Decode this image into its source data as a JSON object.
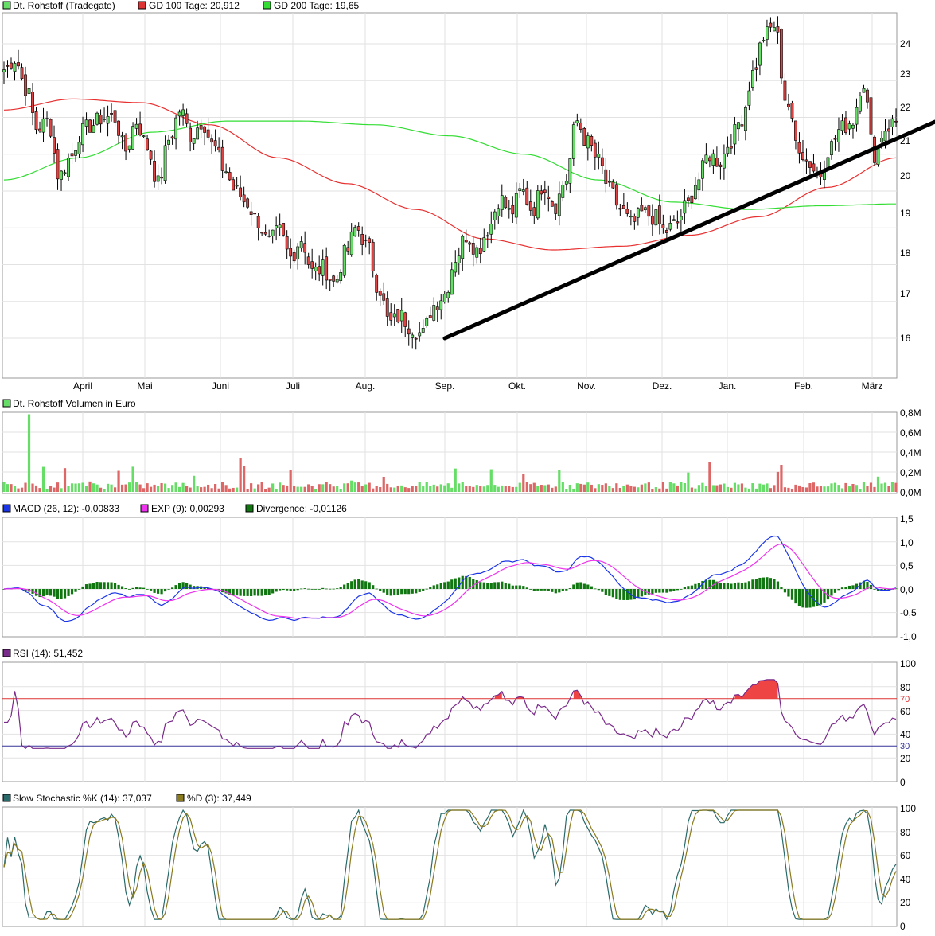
{
  "colors": {
    "up": "#66dd66",
    "down": "#dd4444",
    "gd100": "#e83030",
    "gd200": "#33dd33",
    "macd": "#1a35e8",
    "exp": "#ee33ee",
    "divergence": "#107710",
    "rsi": "#7a2a8a",
    "rsi_fill": "#ee4444",
    "stoch_k": "#2a6a6a",
    "stoch_d": "#8a7a20",
    "trendline": "#000000",
    "rsi70": "#dd3333",
    "rsi30": "#333399"
  },
  "months": [
    "April",
    "Mai",
    "Juni",
    "Juli",
    "Aug.",
    "Sep.",
    "Okt.",
    "Nov.",
    "Dez.",
    "Jan.",
    "Feb.",
    "März"
  ],
  "legends": {
    "price": [
      {
        "label": "Dt. Rohstoff (Tradegate)",
        "color": "#66dd66"
      },
      {
        "label": "GD 100 Tage: 20,912",
        "color": "#dd3333"
      },
      {
        "label": "GD 200 Tage: 19,65",
        "color": "#33dd33"
      }
    ],
    "volume": [
      {
        "label": "Dt. Rohstoff Volumen in Euro",
        "color": "#66dd66"
      }
    ],
    "macd": [
      {
        "label": "MACD (26, 12): -0,00833",
        "color": "#1a35e8"
      },
      {
        "label": "EXP (9): 0,00293",
        "color": "#ee33ee"
      },
      {
        "label": "Divergence: -0,01126",
        "color": "#107710"
      }
    ],
    "rsi": [
      {
        "label": "RSI (14): 51,452",
        "color": "#7a2a8a"
      }
    ],
    "stoch": [
      {
        "label": "Slow Stochastic %K (14): 37,037",
        "color": "#2a6a6a"
      },
      {
        "label": "%D (3): 37,449",
        "color": "#8a7a20"
      }
    ]
  },
  "chart_data": [
    {
      "type": "candlestick",
      "panel": "price",
      "title": "Dt. Rohstoff (Tradegate)",
      "y_ticks": [
        "16",
        "17",
        "18",
        "19",
        "20",
        "21",
        "22",
        "23",
        "24"
      ],
      "ylim": [
        15,
        25
      ],
      "x_labels": [
        "April",
        "Mai",
        "Juni",
        "Juli",
        "Aug.",
        "Sep.",
        "Okt.",
        "Nov.",
        "Dez.",
        "Jan.",
        "Feb.",
        "März"
      ],
      "close_anchors": [
        [
          "Mär",
          23.3
        ],
        [
          "Mär",
          23.6
        ],
        [
          "Mär",
          22.8
        ],
        [
          "Apr",
          21.7
        ],
        [
          "Apr",
          21.9
        ],
        [
          "Apr",
          20.4
        ],
        [
          "Apr",
          20.9
        ],
        [
          "Apr",
          21.6
        ],
        [
          "Apr",
          21.8
        ],
        [
          "Apr",
          22.0
        ],
        [
          "Mai",
          22.0
        ],
        [
          "Mai",
          21.1
        ],
        [
          "Mai",
          21.9
        ],
        [
          "Mai",
          21.2
        ],
        [
          "Mai",
          20.2
        ],
        [
          "Mai",
          21.4
        ],
        [
          "Mai",
          22.2
        ],
        [
          "Mai",
          21.5
        ],
        [
          "Jun",
          21.9
        ],
        [
          "Jun",
          21.2
        ],
        [
          "Jun",
          20.6
        ],
        [
          "Jun",
          20.0
        ],
        [
          "Jun",
          19.7
        ],
        [
          "Jun",
          19.2
        ],
        [
          "Jun",
          18.6
        ],
        [
          "Jul",
          18.9
        ],
        [
          "Jul",
          18.2
        ],
        [
          "Jul",
          18.7
        ],
        [
          "Jul",
          17.8
        ],
        [
          "Jul",
          17.9
        ],
        [
          "Jul",
          17.5
        ],
        [
          "Jul",
          18.3
        ],
        [
          "Aug",
          19.0
        ],
        [
          "Aug",
          18.5
        ],
        [
          "Aug",
          17.4
        ],
        [
          "Aug",
          16.4
        ],
        [
          "Aug",
          16.6
        ],
        [
          "Aug",
          16.3
        ],
        [
          "Sep",
          16.1
        ],
        [
          "Sep",
          16.9
        ],
        [
          "Sep",
          17.2
        ],
        [
          "Sep",
          18.2
        ],
        [
          "Sep",
          18.8
        ],
        [
          "Sep",
          18.4
        ],
        [
          "Okt",
          19.0
        ],
        [
          "Okt",
          19.8
        ],
        [
          "Okt",
          19.4
        ],
        [
          "Okt",
          20.0
        ],
        [
          "Okt",
          19.5
        ],
        [
          "Okt",
          20.2
        ],
        [
          "Okt",
          19.6
        ],
        [
          "Nov",
          20.3
        ],
        [
          "Nov",
          21.9
        ],
        [
          "Nov",
          21.3
        ],
        [
          "Nov",
          20.8
        ],
        [
          "Nov",
          20.0
        ],
        [
          "Nov",
          19.5
        ],
        [
          "Dez",
          19.1
        ],
        [
          "Dez",
          19.4
        ],
        [
          "Dez",
          19.3
        ],
        [
          "Dez",
          18.9
        ],
        [
          "Dez",
          19.1
        ],
        [
          "Dez",
          19.6
        ],
        [
          "Dez",
          20.3
        ],
        [
          "Jan",
          21.0
        ],
        [
          "Jan",
          20.8
        ],
        [
          "Jan",
          21.4
        ],
        [
          "Jan",
          22.0
        ],
        [
          "Jan",
          23.2
        ],
        [
          "Jan",
          24.2
        ],
        [
          "Jan",
          24.5
        ],
        [
          "Feb",
          22.5
        ],
        [
          "Feb",
          21.3
        ],
        [
          "Feb",
          20.8
        ],
        [
          "Feb",
          20.4
        ],
        [
          "Feb",
          21.2
        ],
        [
          "Feb",
          21.7
        ],
        [
          "Feb",
          21.9
        ],
        [
          "Mär",
          23.0
        ],
        [
          "Mär",
          21.0
        ],
        [
          "Mär",
          21.7
        ],
        [
          "Mär",
          21.9
        ]
      ],
      "series": [
        {
          "name": "GD 100 Tage: 20,912"
        },
        {
          "name": "GD 200 Tage: 19,65"
        }
      ]
    },
    {
      "type": "bar",
      "panel": "volume",
      "title": "Dt. Rohstoff Volumen in Euro",
      "y_ticks": [
        "0,0M",
        "0,2M",
        "0,4M",
        "0,6M",
        "0,8M"
      ],
      "ylim": [
        0,
        0.8
      ]
    },
    {
      "type": "line",
      "panel": "macd",
      "y_ticks": [
        "1,5",
        "1,0",
        "0,5",
        "0,0",
        "-0,5",
        "-1,0"
      ],
      "ylim": [
        -1.0,
        1.5
      ],
      "series": [
        {
          "name": "MACD (26, 12): -0,00833"
        },
        {
          "name": "EXP (9): 0,00293"
        },
        {
          "name": "Divergence: -0,01126"
        }
      ]
    },
    {
      "type": "line",
      "panel": "rsi",
      "y_ticks": [
        "100",
        "80",
        "60",
        "40",
        "20",
        "0"
      ],
      "ylim": [
        0,
        100
      ],
      "reference_lines": [
        {
          "label": "70",
          "value": 70
        },
        {
          "label": "30",
          "value": 30
        }
      ],
      "series": [
        {
          "name": "RSI (14): 51,452"
        }
      ]
    },
    {
      "type": "line",
      "panel": "stoch",
      "y_ticks": [
        "100",
        "80",
        "60",
        "40",
        "20",
        "0"
      ],
      "ylim": [
        0,
        100
      ],
      "series": [
        {
          "name": "Slow Stochastic %K (14): 37,037"
        },
        {
          "name": "%D (3): 37,449"
        }
      ]
    }
  ]
}
